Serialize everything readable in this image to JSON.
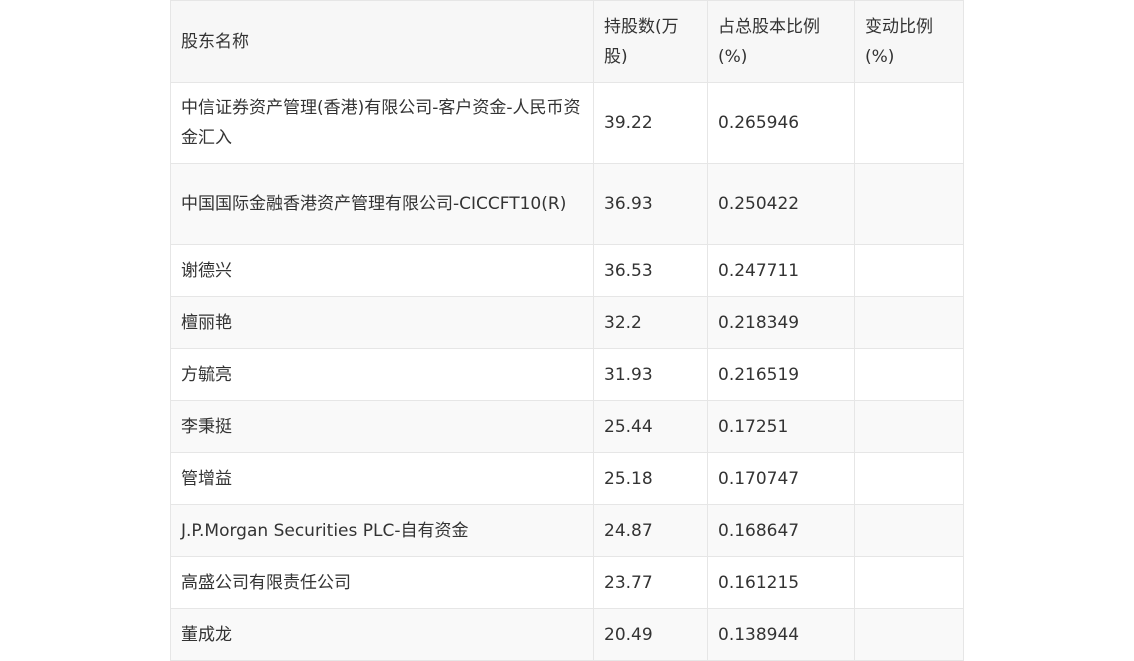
{
  "table": {
    "headers": [
      "股东名称",
      "持股数(万股)",
      "占总股本比例(%)",
      "变动比例(%)"
    ],
    "rows": [
      [
        "中信证券资产管理(香港)有限公司-客户资金-人民币资金汇入",
        "39.22",
        "0.265946",
        ""
      ],
      [
        "中国国际金融香港资产管理有限公司-CICCFT10(R)",
        "36.93",
        "0.250422",
        ""
      ],
      [
        "谢德兴",
        "36.53",
        "0.247711",
        ""
      ],
      [
        "檀丽艳",
        "32.2",
        "0.218349",
        ""
      ],
      [
        "方毓亮",
        "31.93",
        "0.216519",
        ""
      ],
      [
        "李秉挺",
        "25.44",
        "0.17251",
        ""
      ],
      [
        "管增益",
        "25.18",
        "0.170747",
        ""
      ],
      [
        "J.P.Morgan Securities PLC-自有资金",
        "24.87",
        "0.168647",
        ""
      ],
      [
        "高盛公司有限责任公司",
        "23.77",
        "0.161215",
        ""
      ],
      [
        "董成龙",
        "20.49",
        "0.138944",
        ""
      ]
    ]
  }
}
